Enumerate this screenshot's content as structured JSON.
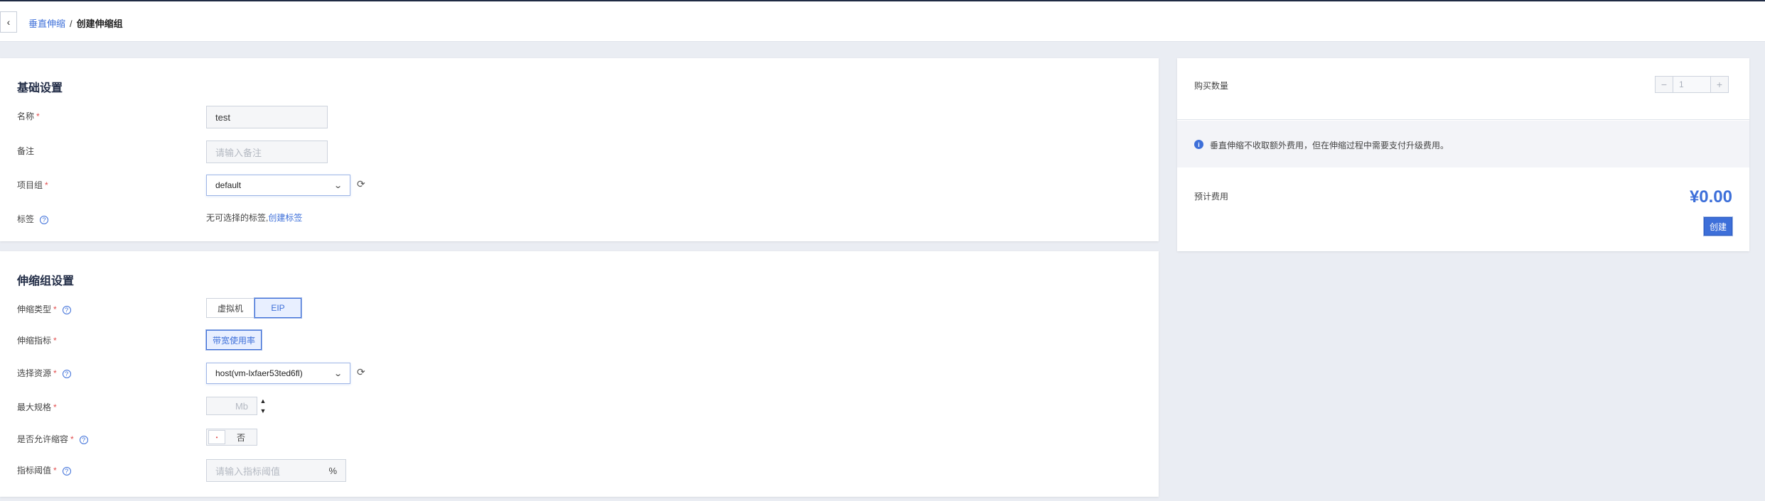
{
  "breadcrumb": {
    "parent": "垂直伸缩",
    "separator": "/",
    "current": "创建伸缩组"
  },
  "basic": {
    "title": "基础设置",
    "name_label": "名称",
    "name_value": "test",
    "remark_label": "备注",
    "remark_placeholder": "请输入备注",
    "project_label": "项目组",
    "project_value": "default",
    "tag_label": "标签",
    "tag_text": "无可选择的标签,",
    "tag_link": "创建标签"
  },
  "scale": {
    "title": "伸缩组设置",
    "type_label": "伸缩类型",
    "type_options": [
      "虚拟机",
      "EIP"
    ],
    "type_selected": "EIP",
    "metric_label": "伸缩指标",
    "metric_value": "带宽使用率",
    "resource_label": "选择资源",
    "resource_value": "host(vm-lxfaer53ted6fl)",
    "max_label": "最大规格",
    "max_unit": "Mb",
    "allow_shrink_label": "是否允许缩容",
    "allow_shrink_value": "否",
    "threshold_label": "指标阈值",
    "threshold_placeholder": "请输入指标阈值",
    "threshold_unit": "%"
  },
  "side": {
    "qty_label": "购买数量",
    "qty_value": "1",
    "qty_minus": "−",
    "qty_plus": "+",
    "notice": "垂直伸缩不收取额外费用，但在伸缩过程中需要支付升级费用。",
    "cost_label": "预计费用",
    "price": "¥0.00",
    "create_label": "创建"
  },
  "icons": {
    "back": "chevron-left-icon",
    "refresh": "refresh-icon",
    "help": "question-circle-icon",
    "info": "info-circle-icon",
    "select_arrow": "chevron-down-icon"
  },
  "colors": {
    "accent": "#3d6fd9",
    "required": "#e24c4c",
    "background": "#eaedf3"
  }
}
